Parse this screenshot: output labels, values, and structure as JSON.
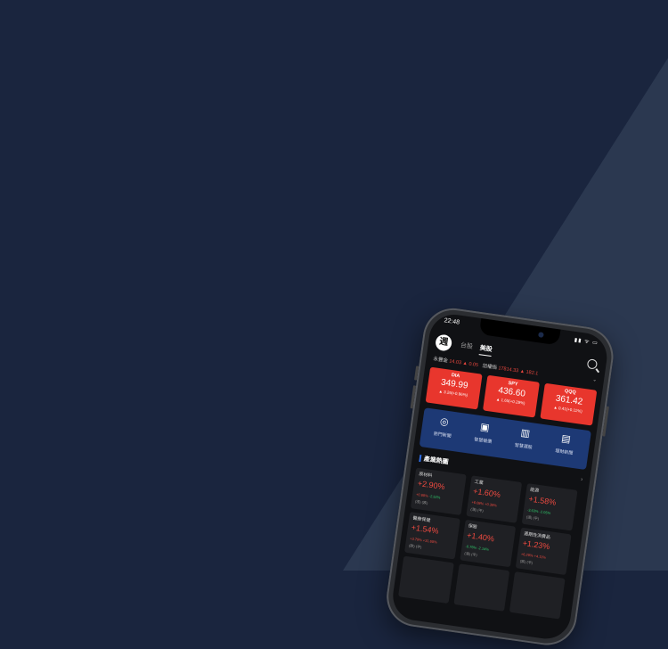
{
  "colors": {
    "background": "#1a253e",
    "diagonal": "#2b3850",
    "up_red": "#e8362d",
    "down_green": "#2fc96b",
    "quick_blue": "#1d3975"
  },
  "status": {
    "time": "22:48",
    "icons": "▮▮ ᯤ ▭"
  },
  "header": {
    "logo": "週",
    "tabs": [
      {
        "label": "台股"
      },
      {
        "label": "美股"
      }
    ]
  },
  "ticker": {
    "item1_name": "永豐金",
    "item1_price": "14.03",
    "item1_change": "▲ 0.05",
    "item2_name": "加權指",
    "item2_price": "17814.33",
    "item2_change": "▲ 182.1"
  },
  "index_cards": [
    {
      "symbol": "DIA",
      "price": "349.99",
      "change": "▲ 3.26(+0.96%)"
    },
    {
      "symbol": "SPY",
      "price": "436.60",
      "change": "▲ 1.65(+0.29%)"
    },
    {
      "symbol": "QQQ",
      "price": "361.42",
      "change": "▲ 0.41(+0.11%)"
    }
  ],
  "quick_actions": [
    {
      "label": "熱門新聞",
      "icon": "globe-icon"
    },
    {
      "label": "智慧報價",
      "icon": "chart-book-icon"
    },
    {
      "label": "智慧選股",
      "icon": "bar-chart-icon"
    },
    {
      "label": "理財新聞",
      "icon": "news-icon"
    }
  ],
  "section": {
    "title": "產業熱圖",
    "more": "›"
  },
  "sectors": [
    {
      "name": "原材料",
      "pct": "+2.90%",
      "sub_a": "+0.65%",
      "sub_b": "-2.52%",
      "foot": "(漲)   (跌)"
    },
    {
      "name": "工業",
      "pct": "+1.60%",
      "sub_a": "+6.08%",
      "sub_b": "+0.39%",
      "foot": "(漲)   (平)"
    },
    {
      "name": "能源",
      "pct": "+1.58%",
      "sub_a": "-3.63%",
      "sub_b": "-2.05%",
      "foot": "(漲)   (平)"
    },
    {
      "name": "醫療保健",
      "pct": "+1.54%",
      "sub_a": "+3.79%",
      "sub_b": "+31.65%",
      "foot": "(跌)   (平)"
    },
    {
      "name": "保險",
      "pct": "+1.40%",
      "sub_a": "-0.76%",
      "sub_b": "-2.14%",
      "foot": "(漲)   (平)"
    },
    {
      "name": "週期性消費品",
      "pct": "+1.23%",
      "sub_a": "+6.29%",
      "sub_b": "+4.11%",
      "foot": "(跌)   (平)"
    }
  ]
}
